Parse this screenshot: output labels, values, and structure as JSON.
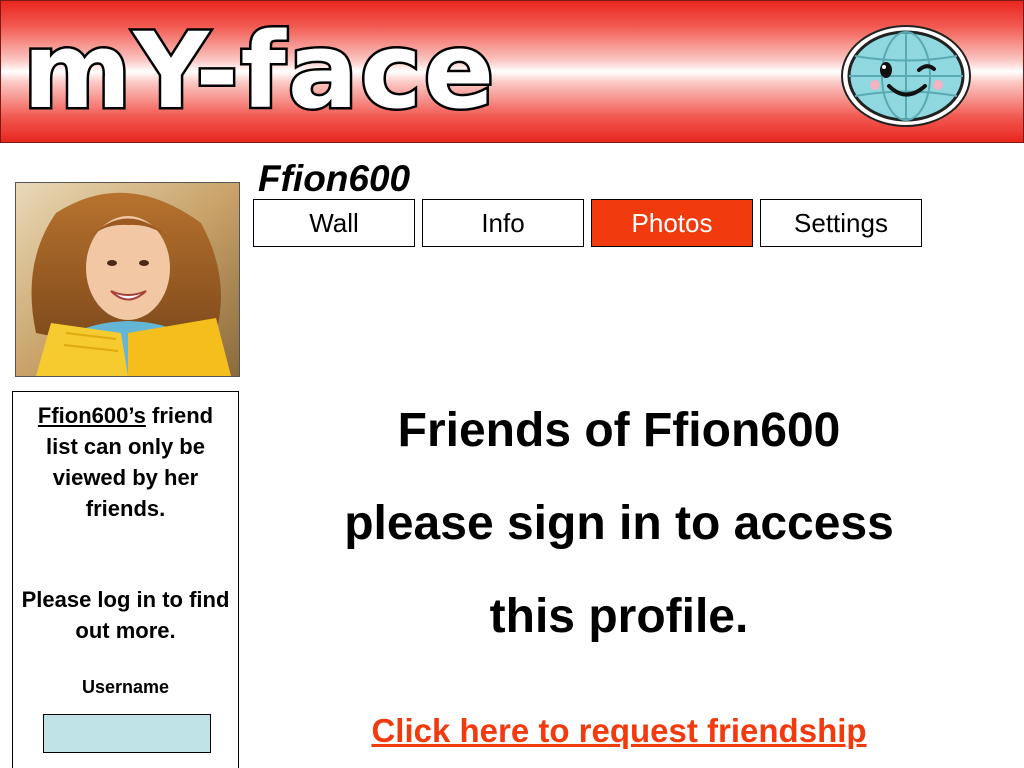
{
  "header": {
    "logo_text": "mY-face",
    "globe_icon": "smiling-globe-icon"
  },
  "profile": {
    "name": "Ffion600",
    "photo": "profile-photo"
  },
  "tabs": [
    {
      "label": "Wall",
      "active": false
    },
    {
      "label": "Info",
      "active": false
    },
    {
      "label": "Photos",
      "active": true
    },
    {
      "label": "Settings",
      "active": false
    }
  ],
  "sidebar": {
    "owner_possessive": "Ffion600’s",
    "restriction_text": " friend list can only be viewed by her friends.",
    "login_prompt": "Please log in to find out more.",
    "username_label": "Username",
    "username_value": ""
  },
  "main": {
    "heading_line1": "Friends of Ffion600",
    "heading_line2": "please sign in to access",
    "heading_line3": "this profile.",
    "request_link": "Click here to request friendship"
  },
  "colors": {
    "accent": "#f23a0f",
    "banner_red": "#e8261e",
    "globe_fill": "#8fd8df",
    "input_fill": "#bfe3e6"
  }
}
